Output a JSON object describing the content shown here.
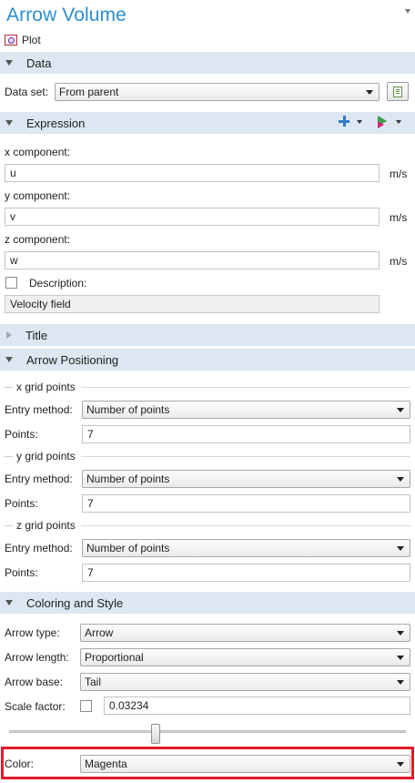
{
  "header": {
    "title": "Arrow Volume",
    "plot_label": "Plot"
  },
  "sections": {
    "data": "Data",
    "expression": "Expression",
    "title": "Title",
    "arrow_positioning": "Arrow Positioning",
    "coloring": "Coloring and Style"
  },
  "data_section": {
    "label": "Data set:",
    "value": "From parent"
  },
  "expression": {
    "x_label": "x component:",
    "x_value": "u",
    "x_unit": "m/s",
    "y_label": "y component:",
    "y_value": "v",
    "y_unit": "m/s",
    "z_label": "z component:",
    "z_value": "w",
    "z_unit": "m/s",
    "description_label": "Description:",
    "description_checked": false,
    "description_value": "Velocity field"
  },
  "positioning": {
    "x_group": "x grid points",
    "y_group": "y grid points",
    "z_group": "z grid points",
    "entry_label": "Entry method:",
    "entry_value": "Number of points",
    "points_label": "Points:",
    "x_points": "7",
    "y_points": "7",
    "z_points": "7"
  },
  "coloring": {
    "arrow_type_label": "Arrow type:",
    "arrow_type_value": "Arrow",
    "arrow_length_label": "Arrow length:",
    "arrow_length_value": "Proportional",
    "arrow_base_label": "Arrow base:",
    "arrow_base_value": "Tail",
    "scale_label": "Scale factor:",
    "scale_checked": false,
    "scale_value": "0.03234",
    "slider_fraction": 0.37,
    "color_label": "Color:",
    "color_value": "Magenta"
  },
  "icons": {
    "plot": "plot-icon",
    "dataset_button": "dataset-select-icon",
    "replace_expression": "plus-icon",
    "insert_expression": "flag-icon"
  },
  "colors": {
    "accent": "#2a8fd0",
    "section_bg": "#dde7f1",
    "highlight": "#e21a2b"
  }
}
